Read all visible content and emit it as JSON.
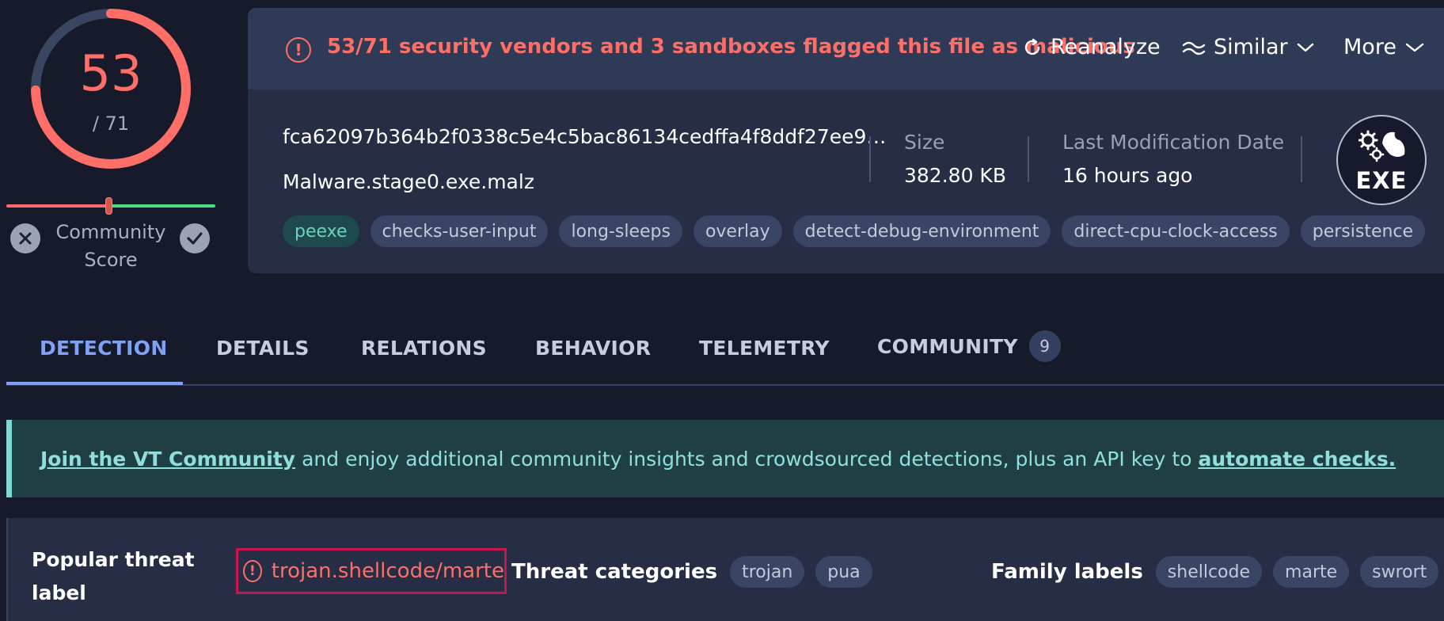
{
  "score": {
    "detections": "53",
    "total": "/ 71",
    "community_label": "Community Score"
  },
  "colors": {
    "malicious": "#ff6f67",
    "accent": "#7fa2f5",
    "banner_text": "#8fe0dc",
    "highlight_box": "#c8154d"
  },
  "alert": {
    "icon": "alert-circle-icon",
    "text": "53/71 security vendors and 3 sandboxes flagged this file as malicious"
  },
  "actions": {
    "reanalyze": "Reanalyze",
    "similar": "Similar",
    "more": "More"
  },
  "file": {
    "hash": "fca62097b364b2f0338c5e4c5bac86134cedffa4f8ddf27ee9…",
    "name": "Malware.stage0.exe.malz",
    "size_label": "Size",
    "size_value": "382.80 KB",
    "modified_label": "Last Modification Date",
    "modified_value": "16 hours ago",
    "type_badge": "EXE",
    "tags": [
      "peexe",
      "checks-user-input",
      "long-sleeps",
      "overlay",
      "detect-debug-environment",
      "direct-cpu-clock-access",
      "persistence"
    ]
  },
  "tabs": [
    {
      "label": "DETECTION"
    },
    {
      "label": "DETAILS"
    },
    {
      "label": "RELATIONS"
    },
    {
      "label": "BEHAVIOR"
    },
    {
      "label": "TELEMETRY"
    },
    {
      "label": "COMMUNITY",
      "count": "9"
    }
  ],
  "banner": {
    "link1": "Join the VT Community",
    "middle": "and enjoy additional community insights and crowdsourced detections, plus an API key to",
    "link2": "automate checks."
  },
  "threat": {
    "title": "Popular threat label",
    "label": "trojan.shellcode/marte",
    "categories_title": "Threat categories",
    "categories": [
      "trojan",
      "pua"
    ],
    "family_title": "Family labels",
    "families": [
      "shellcode",
      "marte",
      "swrort"
    ]
  }
}
